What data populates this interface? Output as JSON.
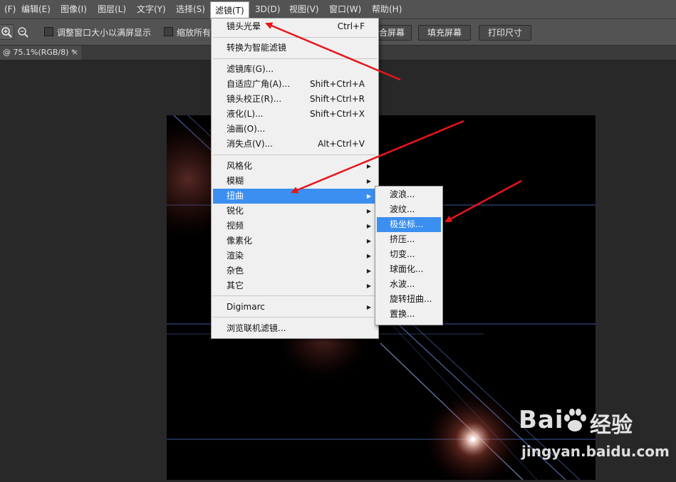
{
  "menubar": {
    "items": [
      "(F)",
      "编辑(E)",
      "图像(I)",
      "图层(L)",
      "文字(Y)",
      "选择(S)",
      "滤镜(T)",
      "3D(D)",
      "视图(V)",
      "窗口(W)",
      "帮助(H)"
    ]
  },
  "options_bar": {
    "resize_windows_label": "调整窗口大小以满屏显示",
    "zoom_all_label": "缩放所有",
    "fit_screen_button": "适合屏幕",
    "fill_screen_button": "填充屏幕",
    "print_size_button": "打印尺寸"
  },
  "document_tab": {
    "title": "@ 75.1%(RGB/8) *",
    "close": "×"
  },
  "filter_menu": {
    "items": [
      {
        "label": "镜头光晕",
        "shortcut": "Ctrl+F"
      },
      {
        "label": "转换为智能滤镜"
      },
      {
        "label": "滤镜库(G)..."
      },
      {
        "label": "自适应广角(A)...",
        "shortcut": "Shift+Ctrl+A"
      },
      {
        "label": "镜头校正(R)...",
        "shortcut": "Shift+Ctrl+R"
      },
      {
        "label": "液化(L)...",
        "shortcut": "Shift+Ctrl+X"
      },
      {
        "label": "油画(O)..."
      },
      {
        "label": "消失点(V)...",
        "shortcut": "Alt+Ctrl+V"
      },
      {
        "label": "风格化"
      },
      {
        "label": "模糊"
      },
      {
        "label": "扭曲"
      },
      {
        "label": "锐化"
      },
      {
        "label": "视频"
      },
      {
        "label": "像素化"
      },
      {
        "label": "渲染"
      },
      {
        "label": "杂色"
      },
      {
        "label": "其它"
      },
      {
        "label": "Digimarc"
      },
      {
        "label": "浏览联机滤镜..."
      }
    ],
    "highlighted": "扭曲"
  },
  "distort_submenu": {
    "items": [
      "波浪...",
      "波纹...",
      "极坐标...",
      "挤压...",
      "切变...",
      "球面化...",
      "水波...",
      "旋转扭曲...",
      "置换..."
    ],
    "highlighted": "极坐标..."
  },
  "watermark": {
    "brand": "Bai",
    "brand_cn": "经验",
    "url": "jingyan.baidu.com"
  },
  "colors": {
    "highlight": "#3b8ff0",
    "arrow": "#e8141a",
    "menu_bg": "#f0f0f0",
    "ui_gray": "#535353"
  }
}
